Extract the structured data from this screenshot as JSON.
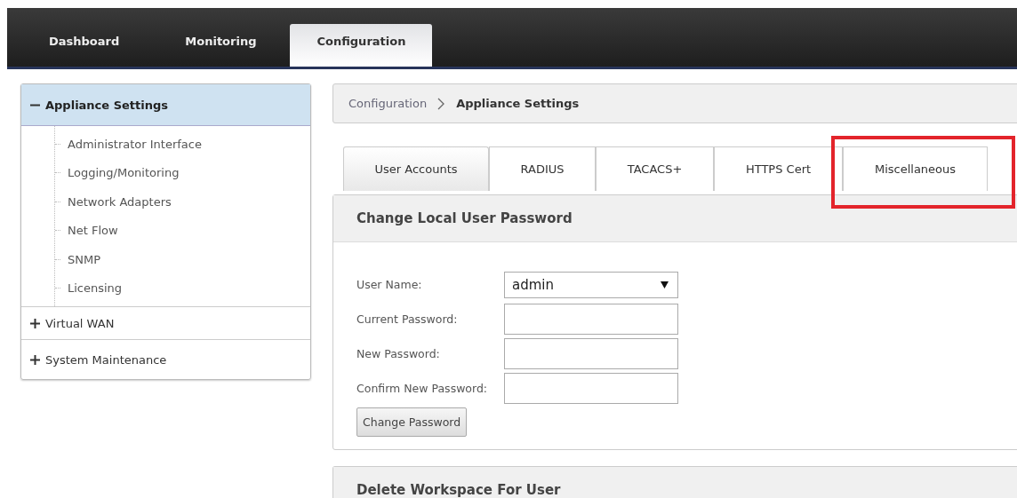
{
  "nav": {
    "tabs": [
      {
        "label": "Dashboard",
        "selected": false
      },
      {
        "label": "Monitoring",
        "selected": false
      },
      {
        "label": "Configuration",
        "selected": true
      }
    ]
  },
  "sidebar": {
    "sections": [
      {
        "label": "Appliance Settings",
        "expanded": true,
        "selected": true,
        "children": [
          "Administrator Interface",
          "Logging/Monitoring",
          "Network Adapters",
          "Net Flow",
          "SNMP",
          "Licensing"
        ]
      },
      {
        "label": "Virtual WAN",
        "expanded": false,
        "selected": false
      },
      {
        "label": "System Maintenance",
        "expanded": false,
        "selected": false
      }
    ]
  },
  "breadcrumb": {
    "parent": "Configuration",
    "current": "Appliance Settings"
  },
  "tabs": [
    {
      "label": "User Accounts",
      "selected": true,
      "highlighted": false
    },
    {
      "label": "RADIUS",
      "selected": false,
      "highlighted": false
    },
    {
      "label": "TACACS+",
      "selected": false,
      "highlighted": false
    },
    {
      "label": "HTTPS Cert",
      "selected": false,
      "highlighted": false
    },
    {
      "label": "Miscellaneous",
      "selected": false,
      "highlighted": true
    }
  ],
  "password_panel": {
    "title": "Change Local User Password",
    "fields": [
      {
        "kind": "select",
        "label": "User Name:",
        "value": "admin"
      },
      {
        "kind": "password",
        "label": "Current Password:"
      },
      {
        "kind": "password",
        "label": "New Password:"
      },
      {
        "kind": "password",
        "label": "Confirm New Password:"
      }
    ],
    "button": "Change Password"
  },
  "workspace_panel": {
    "title": "Delete Workspace For User"
  }
}
